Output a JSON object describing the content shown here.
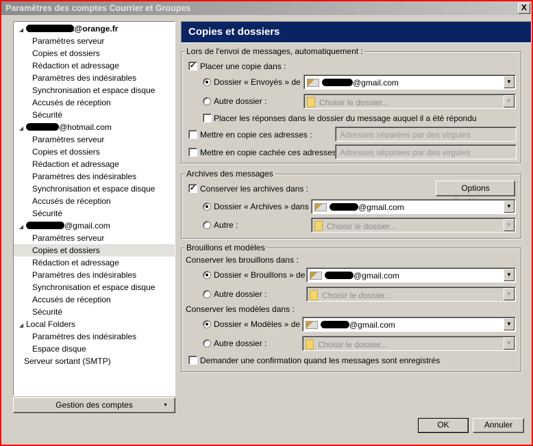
{
  "window": {
    "title": "Paramètres des comptes Courrier et Groupes",
    "close": "X"
  },
  "tree": {
    "accounts": [
      {
        "name": "x@orange.fr",
        "items": [
          "Paramètres serveur",
          "Copies et dossiers",
          "Rédaction et adressage",
          "Paramètres des indésirables",
          "Synchronisation et espace disque",
          "Accusés de réception",
          "Sécurité"
        ]
      },
      {
        "name": "@hotmail.com",
        "items": [
          "Paramètres serveur",
          "Copies et dossiers",
          "Rédaction et adressage",
          "Paramètres des indésirables",
          "Synchronisation et espace disque",
          "Accusés de réception",
          "Sécurité"
        ]
      },
      {
        "name": "@gmail.com",
        "items": [
          "Paramètres serveur",
          "Copies et dossiers",
          "Rédaction et adressage",
          "Paramètres des indésirables",
          "Synchronisation et espace disque",
          "Accusés de réception",
          "Sécurité"
        ]
      },
      {
        "name": "Local Folders",
        "items": [
          "Paramètres des indésirables",
          "Espace disque"
        ]
      }
    ],
    "smtp": "Serveur sortant (SMTP)",
    "selected": "@gmail.com / Copies et dossiers"
  },
  "manage_button": "Gestion des comptes",
  "header": "Copies et dossiers",
  "sending": {
    "legend": "Lors de l'envoi de messages, automatiquement :",
    "place_copy": {
      "label": "Placer une copie dans :",
      "checked": true
    },
    "sent_folder": {
      "label": "Dossier « Envoyés » de :",
      "selected": true,
      "value": "@gmail.com"
    },
    "other_folder": {
      "label": "Autre dossier :",
      "selected": false,
      "value": "Choisir le dossier..."
    },
    "replies": {
      "label": "Placer les réponses dans le dossier du message auquel il a été répondu",
      "checked": false
    },
    "cc": {
      "label": "Mettre en copie ces adresses :",
      "checked": false,
      "placeholder": "Adresses séparées par des virgules"
    },
    "bcc": {
      "label": "Mettre en copie cachée ces adresses :",
      "checked": false,
      "placeholder": "Adresses séparées par des virgules"
    }
  },
  "archives": {
    "legend": "Archives des messages",
    "keep": {
      "label": "Conserver les archives dans :",
      "checked": true
    },
    "options_button": "Options d'archivage...",
    "archive_folder": {
      "label": "Dossier « Archives » dans :",
      "selected": true,
      "value": "@gmail.com"
    },
    "other": {
      "label": "Autre :",
      "selected": false,
      "value": "Choisir le dossier..."
    }
  },
  "drafts": {
    "legend": "Brouillons et modèles",
    "drafts_label": "Conserver les brouillons dans :",
    "drafts_folder": {
      "label": "Dossier « Brouillons » de :",
      "selected": true,
      "value": "@gmail.com"
    },
    "drafts_other": {
      "label": "Autre dossier :",
      "selected": false,
      "value": "Choisir le dossier..."
    },
    "templates_label": "Conserver les modèles dans :",
    "templates_folder": {
      "label": "Dossier « Modèles » de :",
      "selected": true,
      "value": "@gmail.com"
    },
    "templates_other": {
      "label": "Autre dossier :",
      "selected": false,
      "value": "Choisir le dossier..."
    },
    "confirm": {
      "label": "Demander une confirmation quand les messages sont enregistrés",
      "checked": false
    }
  },
  "buttons": {
    "ok": "OK",
    "cancel": "Annuler"
  }
}
